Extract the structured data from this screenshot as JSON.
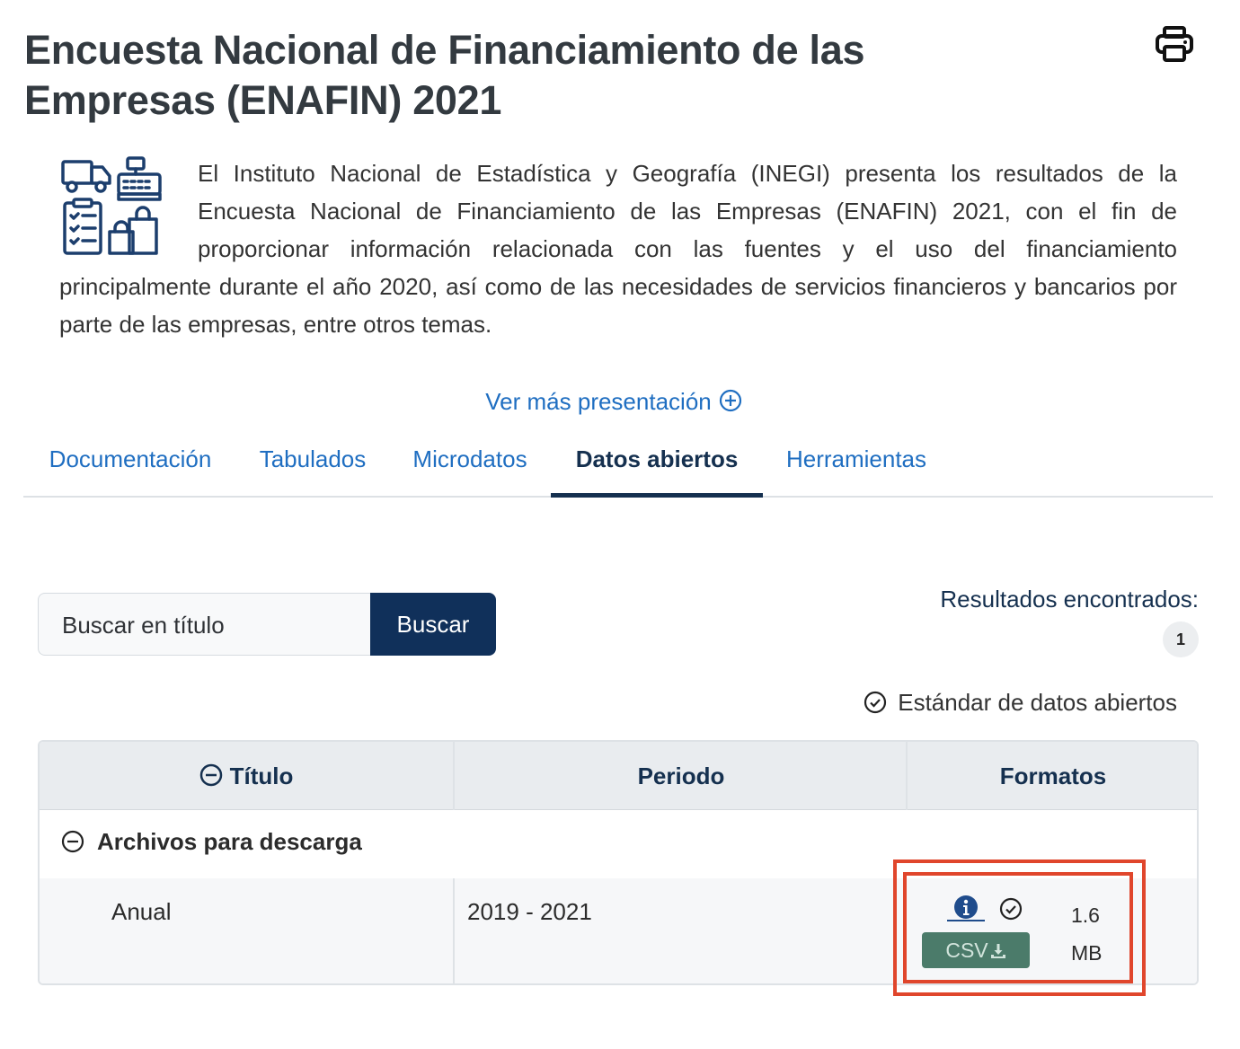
{
  "page": {
    "title": "Encuesta Nacional de Financiamiento de las Empresas (ENAFIN) 2021",
    "intro": "El Instituto Nacional de Estadística y Geografía (INEGI) presenta los resultados de la Encuesta Nacional de Financiamiento de las Empresas (ENAFIN) 2021, con el fin de proporcionar información relacionada con las fuentes y el uso del financiamiento principalmente durante el año 2020, así como de las necesidades de servicios financieros y bancarios por parte de las empresas, entre otros temas.",
    "more_link": "Ver más presentación"
  },
  "icons": {
    "print": "printer-icon",
    "intro": "business-illustration-icon",
    "more": "plus-circle-icon",
    "collapse": "minus-circle-icon",
    "info": "info-icon",
    "check": "check-circle-icon",
    "download": "download-icon"
  },
  "tabs": [
    {
      "label": "Documentación",
      "active": false
    },
    {
      "label": "Tabulados",
      "active": false
    },
    {
      "label": "Microdatos",
      "active": false
    },
    {
      "label": "Datos abiertos",
      "active": true
    },
    {
      "label": "Herramientas",
      "active": false
    }
  ],
  "search": {
    "placeholder": "Buscar en título",
    "button_label": "Buscar"
  },
  "results": {
    "label": "Resultados encontrados:",
    "count": "1"
  },
  "standard_label": "Estándar de datos abiertos",
  "table": {
    "headers": {
      "title": "Título",
      "period": "Periodo",
      "formats": "Formatos"
    },
    "group": "Archivos para descarga",
    "rows": [
      {
        "title": "Anual",
        "period": "2019 - 2021",
        "format": "CSV",
        "size_value": "1.6",
        "size_unit": "MB"
      }
    ]
  },
  "colors": {
    "title": "#333a40",
    "link": "#1f6ec1",
    "navy": "#10305a",
    "csv_button": "#4b7b6a",
    "highlight": "#e0462c"
  }
}
